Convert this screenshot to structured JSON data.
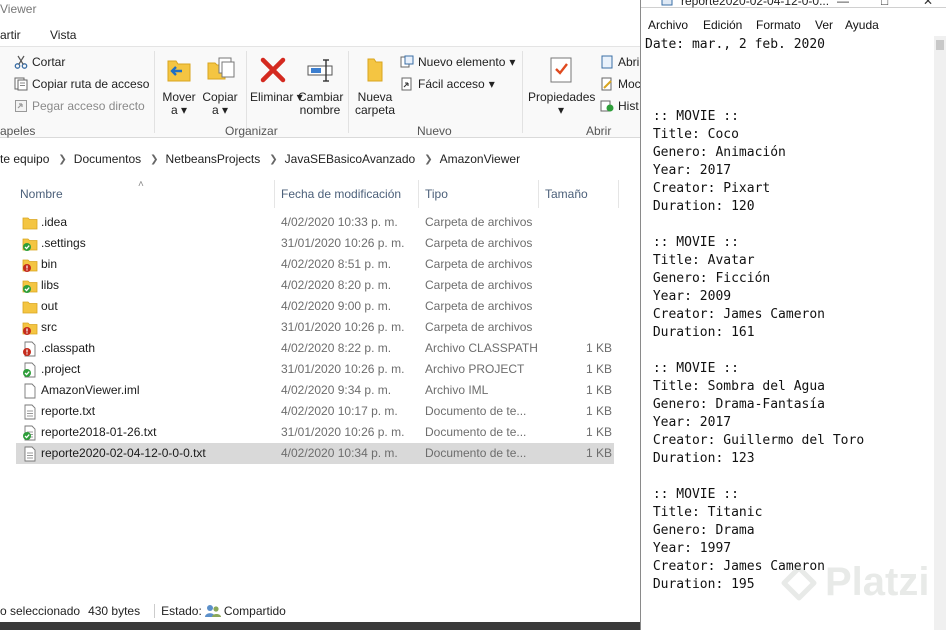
{
  "explorer": {
    "title": "Viewer",
    "tabs": [
      "artir",
      "Vista"
    ],
    "ribbon": {
      "portapapeles": {
        "cortar": "Cortar",
        "copiar_ruta": "Copiar ruta de acceso",
        "pegar_acceso": "Pegar acceso directo",
        "group_label": "apeles"
      },
      "organizar": {
        "mover_l1": "Mover",
        "mover_l2": "a",
        "copiar_l1": "Copiar",
        "copiar_l2": "a",
        "eliminar_l1": "Eliminar",
        "cambiar_l1": "Cambiar",
        "cambiar_l2": "nombre",
        "group_label": "Organizar"
      },
      "nuevo": {
        "nueva_l1": "Nueva",
        "nueva_l2": "carpeta",
        "nuevo_elemento": "Nuevo elemento",
        "facil_acceso": "Fácil acceso",
        "group_label": "Nuevo"
      },
      "abrir": {
        "propiedades": "Propiedades",
        "abrir": "Abri",
        "modificar": "Moc",
        "historial": "Hist",
        "group_label": "Abrir"
      }
    },
    "breadcrumb": [
      "te equipo",
      "Documentos",
      "NetbeansProjects",
      "JavaSEBasicoAvanzado",
      "AmazonViewer"
    ],
    "columns": {
      "name": "Nombre",
      "date": "Fecha de modificación",
      "type": "Tipo",
      "size": "Tamaño"
    },
    "files": [
      {
        "name": ".idea",
        "date": "4/02/2020 10:33 p. m.",
        "type": "Carpeta de archivos",
        "size": "",
        "icon": "folder-icon"
      },
      {
        "name": ".settings",
        "date": "31/01/2020 10:26 p. m.",
        "type": "Carpeta de archivos",
        "size": "",
        "icon": "folder-synced-icon"
      },
      {
        "name": "bin",
        "date": "4/02/2020 8:51 p. m.",
        "type": "Carpeta de archivos",
        "size": "",
        "icon": "folder-error-icon"
      },
      {
        "name": "libs",
        "date": "4/02/2020 8:20 p. m.",
        "type": "Carpeta de archivos",
        "size": "",
        "icon": "folder-synced-icon"
      },
      {
        "name": "out",
        "date": "4/02/2020 9:00 p. m.",
        "type": "Carpeta de archivos",
        "size": "",
        "icon": "folder-icon"
      },
      {
        "name": "src",
        "date": "31/01/2020 10:26 p. m.",
        "type": "Carpeta de archivos",
        "size": "",
        "icon": "folder-error-icon"
      },
      {
        "name": ".classpath",
        "date": "4/02/2020 8:22 p. m.",
        "type": "Archivo CLASSPATH",
        "size": "1 KB",
        "icon": "file-error-icon"
      },
      {
        "name": ".project",
        "date": "31/01/2020 10:26 p. m.",
        "type": "Archivo PROJECT",
        "size": "1 KB",
        "icon": "file-synced-icon"
      },
      {
        "name": "AmazonViewer.iml",
        "date": "4/02/2020 9:34 p. m.",
        "type": "Archivo IML",
        "size": "1 KB",
        "icon": "file-icon"
      },
      {
        "name": "reporte.txt",
        "date": "4/02/2020 10:17 p. m.",
        "type": "Documento de te...",
        "size": "1 KB",
        "icon": "text-file-icon"
      },
      {
        "name": "reporte2018-01-26.txt",
        "date": "31/01/2020 10:26 p. m.",
        "type": "Documento de te...",
        "size": "1 KB",
        "icon": "text-file-synced-icon"
      },
      {
        "name": "reporte2020-02-04-12-0-0-0.txt",
        "date": "4/02/2020 10:34 p. m.",
        "type": "Documento de te...",
        "size": "1 KB",
        "icon": "text-file-icon"
      }
    ],
    "selected_index": 11,
    "status": {
      "selection": "o seleccionado",
      "size": "430 bytes",
      "state_label": "Estado:",
      "state_value": "Compartido"
    }
  },
  "notepad": {
    "title": "reporte2020-02-04-12-0-0...",
    "menu": [
      "Archivo",
      "Edición",
      "Formato",
      "Ver",
      "Ayuda"
    ],
    "lines": [
      "Date: mar., 2 feb. 2020",
      "",
      "",
      "",
      " :: MOVIE ::",
      " Title: Coco",
      " Genero: Animación",
      " Year: 2017",
      " Creator: Pixart",
      " Duration: 120",
      "",
      " :: MOVIE ::",
      " Title: Avatar",
      " Genero: Ficción",
      " Year: 2009",
      " Creator: James Cameron",
      " Duration: 161",
      "",
      " :: MOVIE ::",
      " Title: Sombra del Agua",
      " Genero: Drama-Fantasía",
      " Year: 2017",
      " Creator: Guillermo del Toro",
      " Duration: 123",
      "",
      " :: MOVIE ::",
      " Title: Titanic",
      " Genero: Drama",
      " Year: 1997",
      " Creator: James Cameron",
      " Duration: 195"
    ],
    "watermark": "Platzi"
  },
  "colors": {
    "folder": "#f4c542",
    "synced": "#2e9e3a",
    "error": "#c42b1c",
    "selected_row": "#d9d9d9",
    "delete_red": "#d42a20"
  }
}
